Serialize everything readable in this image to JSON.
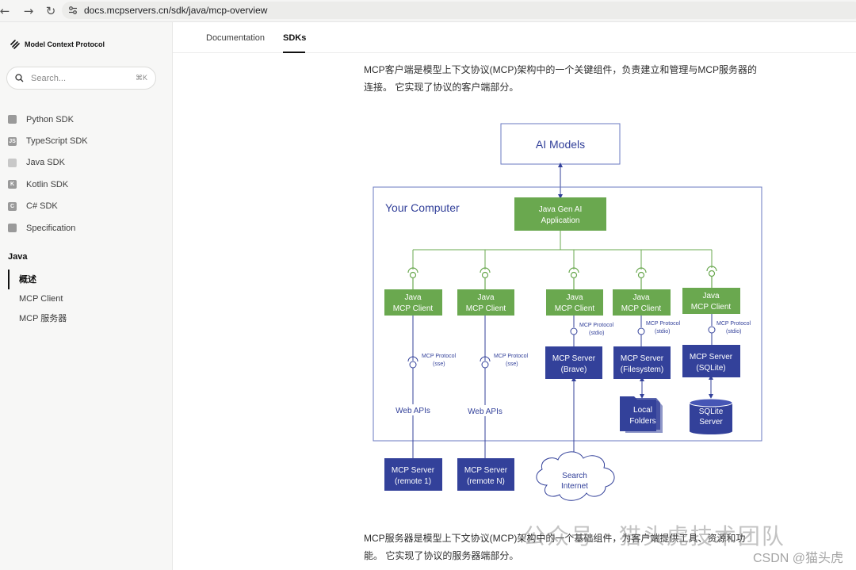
{
  "browser": {
    "url": "docs.mcpservers.cn/sdk/java/mcp-overview",
    "back_icon": "back-arrow-icon",
    "forward_icon": "forward-arrow-icon",
    "reload_icon": "reload-icon"
  },
  "sidebar": {
    "logo_text": "Model Context Protocol",
    "search_placeholder": "Search...",
    "search_shortcut": "⌘K",
    "items": [
      {
        "label": "Python SDK",
        "icon": "python-icon",
        "glyph": ""
      },
      {
        "label": "TypeScript SDK",
        "icon": "typescript-icon",
        "glyph": "JS"
      },
      {
        "label": "Java SDK",
        "icon": "java-icon",
        "glyph": ""
      },
      {
        "label": "Kotlin SDK",
        "icon": "kotlin-icon",
        "glyph": "K"
      },
      {
        "label": "C# SDK",
        "icon": "csharp-icon",
        "glyph": "C"
      },
      {
        "label": "Specification",
        "icon": "book-icon",
        "glyph": ""
      }
    ],
    "section_title": "Java",
    "sub_items": [
      {
        "label": "概述",
        "active": true
      },
      {
        "label": "MCP Client",
        "active": false
      },
      {
        "label": "MCP 服务器",
        "active": false
      }
    ]
  },
  "tabs": [
    {
      "label": "Documentation",
      "active": false
    },
    {
      "label": "SDKs",
      "active": true
    }
  ],
  "content": {
    "intro_line1": "MCP客户端是模型上下文协议(MCP)架构中的一个关键组件，负责建立和管理与MCP服务器的",
    "intro_line2": "连接。 它实现了协议的客户端部分。",
    "outro_line1": "MCP服务器是模型上下文协议(MCP)架构中的一个基础组件，为客户端提供工具、资源和功",
    "outro_line2": "能。 它实现了协议的服务器端部分。"
  },
  "diagram": {
    "ai_models": "AI Models",
    "your_computer": "Your Computer",
    "app_line1": "Java Gen AI",
    "app_line2": "Application",
    "client_line1": "Java",
    "client_line2": "MCP Client",
    "proto_label": "MCP Protocol",
    "proto_sse": "(sse)",
    "proto_stdio": "(stdio)",
    "web_apis": "Web APIs",
    "server_label": "MCP Server",
    "server_brave": "(Brave)",
    "server_fs": "(Filesystem)",
    "server_sqlite": "(SQLite)",
    "remote1": "(remote 1)",
    "remoteN": "(remote N)",
    "local": "Local",
    "folders": "Folders",
    "sqlite": "SQLite",
    "server": "Server",
    "search": "Search",
    "internet": "Internet"
  },
  "watermark": {
    "text": "公众号 · 猫头虎技术团队",
    "csdn": "CSDN @猫头虎"
  },
  "colors": {
    "green": "#6aa84f",
    "navy": "#33419a",
    "frame": "#6a78c0"
  }
}
